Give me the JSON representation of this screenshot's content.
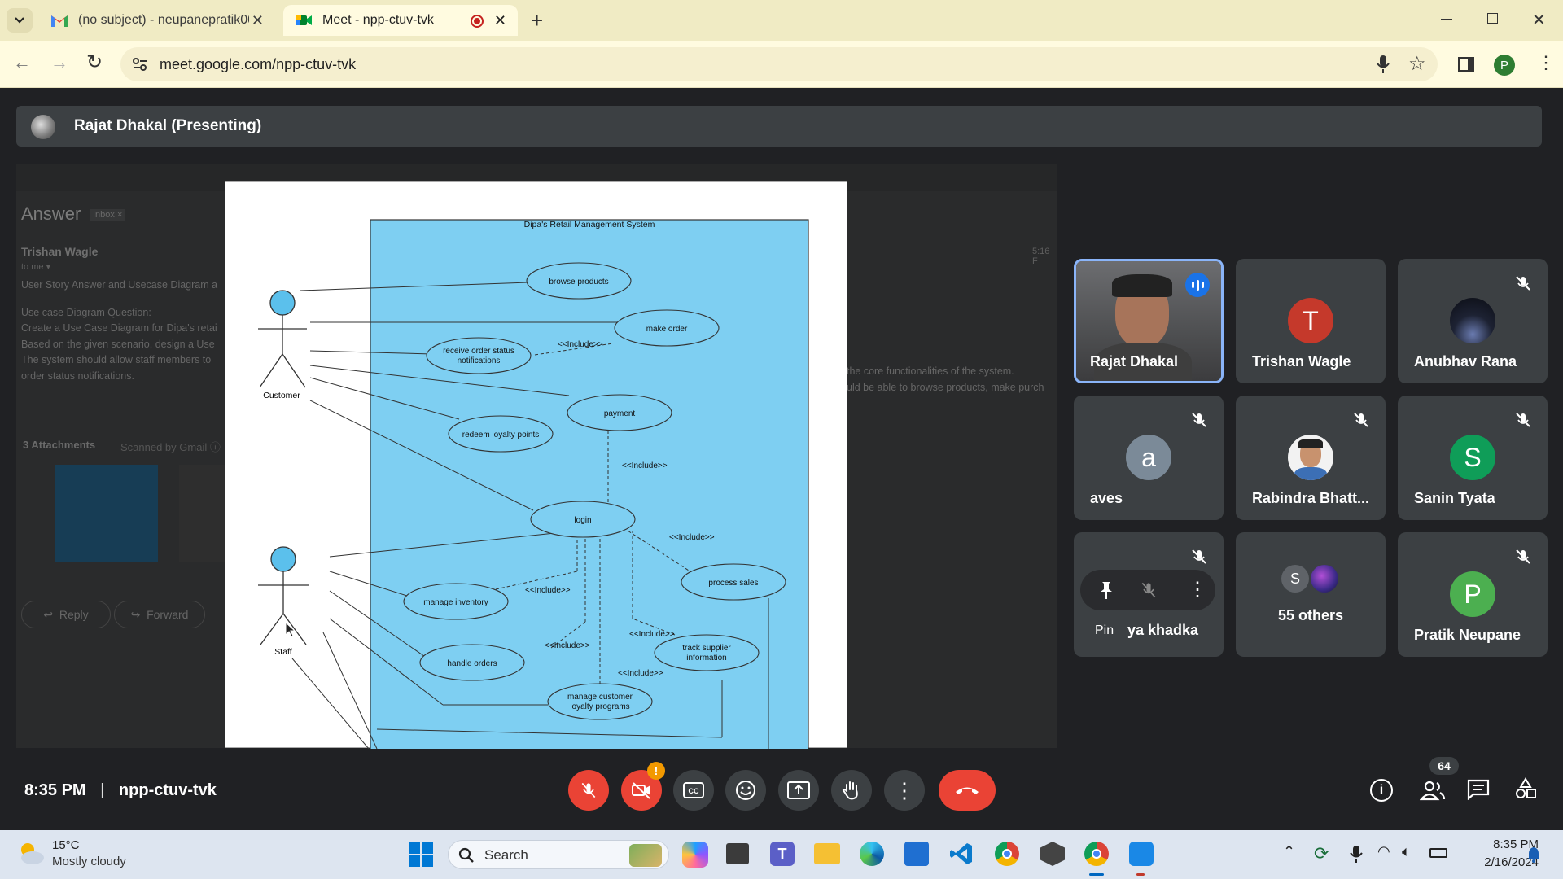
{
  "browser": {
    "tabs": [
      {
        "title": "(no subject) - neupanepratik00",
        "icon": "gmail-icon",
        "active": false
      },
      {
        "title": "Meet - npp-ctuv-tvk",
        "icon": "meet-icon",
        "active": true,
        "recording": true
      }
    ],
    "url": "meet.google.com/npp-ctuv-tvk",
    "profile_initial": "P"
  },
  "meet": {
    "presenter_label": "Rajat Dhakal (Presenting)",
    "time": "8:35 PM",
    "separator": "|",
    "meeting_code": "npp-ctuv-tvk",
    "people_count": "64",
    "participants": [
      {
        "name": "Rajat Dhakal",
        "type": "video",
        "speaking": true
      },
      {
        "name": "Trishan Wagle",
        "initial": "T",
        "color": "#c5392b",
        "muted": false
      },
      {
        "name": "Anubhav Rana",
        "type": "photo",
        "muted": true
      },
      {
        "name": "aves",
        "initial": "a",
        "color": "#7b8a98",
        "muted": true
      },
      {
        "name": "Rabindra Bhatt...",
        "type": "photo",
        "muted": true
      },
      {
        "name": "Sanin Tyata",
        "initial": "S",
        "color": "#0f9d58",
        "muted": true
      },
      {
        "name": "ya khadka",
        "hover_label": "Pin",
        "muted": true
      },
      {
        "name": "55 others",
        "initial": "S",
        "color": "#5f6368"
      },
      {
        "name": "Pratik Neupane",
        "initial": "P",
        "color": "#4caf50",
        "muted": true
      }
    ],
    "alert_badge": "!"
  },
  "background_email": {
    "subject": "Answer",
    "label": "Inbox ×",
    "sender": "Trishan Wagle",
    "to": "to me ▾",
    "lines": [
      "User Story Answer and Usecase Diagram a",
      "Use case Diagram Question:",
      "Create a Use Case Diagram for Dipa's retai",
      "Based on the given scenario, design a Use",
      "The system should allow staff members to",
      "order status notifications."
    ],
    "right_lines": [
      "the core functionalities of the system.",
      "uld be able to browse products, make purch"
    ],
    "attachments": "3 Attachments",
    "scanned": "Scanned by Gmail ⓘ",
    "reply": "Reply",
    "forward": "Forward",
    "time": "5:16 F"
  },
  "diagram": {
    "system_title": "Dipa's Retail Management System",
    "actors": [
      "Customer",
      "Staff"
    ],
    "use_cases": [
      "browse products",
      "make order",
      "receive order status",
      "notifications",
      "payment",
      "redeem loyalty points",
      "login",
      "process sales",
      "manage inventory",
      "handle orders",
      "track supplier",
      "information",
      "manage customer",
      "loyalty programs"
    ],
    "include_label": "<<Include>>"
  },
  "taskbar": {
    "temperature": "15°C",
    "weather": "Mostly cloudy",
    "search": "Search",
    "clock_time": "8:35 PM",
    "clock_date": "2/16/2024"
  }
}
